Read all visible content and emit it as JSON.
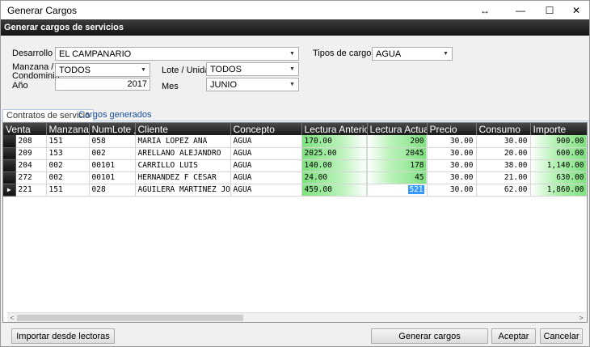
{
  "window": {
    "title": "Generar Cargos",
    "resize_icon": "↔",
    "minimize_icon": "—",
    "maximize_icon": "☐",
    "close_icon": "✕"
  },
  "header": {
    "title": "Generar cargos de servicios"
  },
  "filters": {
    "desarrollo_label": "Desarrollo",
    "desarrollo_value": "EL CAMPANARIO",
    "tipos_cargo_label": "Tipos de cargo",
    "tipos_cargo_value": "AGUA",
    "manzana_label_1": "Manzana /",
    "manzana_label_2": "Condominio",
    "manzana_value": "TODOS",
    "lote_label": "Lote / Unidad",
    "lote_value": "TODOS",
    "anio_label": "Año",
    "anio_value": "2017",
    "mes_label": "Mes",
    "mes_value": "JUNIO"
  },
  "tabs": [
    {
      "label": "Contratos de servicio",
      "active": true
    },
    {
      "label": "Cargos generados",
      "active": false
    }
  ],
  "grid": {
    "columns": [
      "Venta",
      "Manzana",
      "NumLote",
      "Cliente",
      "Concepto",
      "Lectura Anterio",
      "Lectura Actual",
      "Precio",
      "Consumo",
      "Importe"
    ],
    "sort_icon": "△",
    "current_row_icon": "▶",
    "rows": [
      {
        "venta": "208",
        "manzana": "151",
        "numlote": "058",
        "cliente": "MARIA LOPEZ ANA",
        "concepto": "AGUA",
        "lectura_anterior": "170.00",
        "lectura_actual": "200",
        "precio": "30.00",
        "consumo": "30.00",
        "importe": "900.00"
      },
      {
        "venta": "209",
        "manzana": "153",
        "numlote": "002",
        "cliente": "ARELLANO  ALEJANDRO",
        "concepto": "AGUA",
        "lectura_anterior": "2025.00",
        "lectura_actual": "2045",
        "precio": "30.00",
        "consumo": "20.00",
        "importe": "600.00"
      },
      {
        "venta": "204",
        "manzana": "002",
        "numlote": "00101",
        "cliente": "CARRILLO  LUIS",
        "concepto": "AGUA",
        "lectura_anterior": "140.00",
        "lectura_actual": "178",
        "precio": "30.00",
        "consumo": "38.00",
        "importe": "1,140.00"
      },
      {
        "venta": "272",
        "manzana": "002",
        "numlote": "00101",
        "cliente": "HERNANDEZ F CESAR",
        "concepto": "AGUA",
        "lectura_anterior": "24.00",
        "lectura_actual": "45",
        "precio": "30.00",
        "consumo": "21.00",
        "importe": "630.00"
      },
      {
        "venta": "221",
        "manzana": "151",
        "numlote": "028",
        "cliente": "AGUILERA MARTINEZ JOS",
        "concepto": "AGUA",
        "lectura_anterior": "459.00",
        "lectura_actual": "521",
        "precio": "30.00",
        "consumo": "62.00",
        "importe": "1,860.00"
      }
    ]
  },
  "buttons": {
    "importar": "Importar desde lectoras",
    "generar": "Generar cargos",
    "aceptar": "Aceptar",
    "cancelar": "Cancelar"
  },
  "scrollbar": {
    "left_icon": "<",
    "right_icon": ">"
  }
}
